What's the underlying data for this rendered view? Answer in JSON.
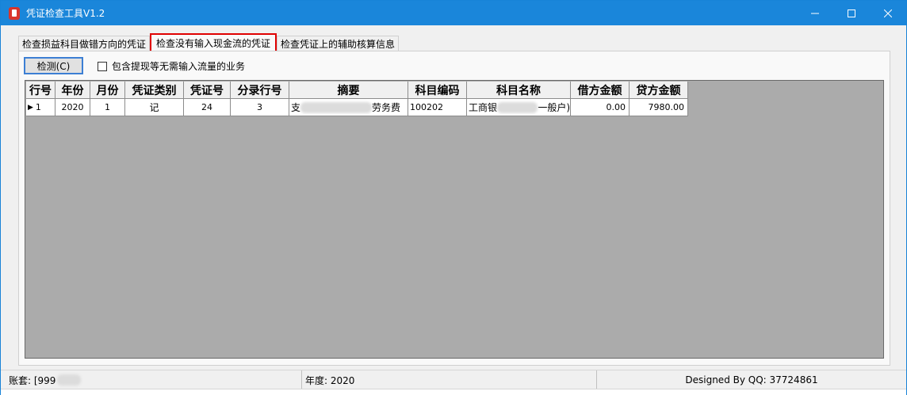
{
  "window": {
    "title": "凭证检查工具V1.2",
    "controls": {
      "minimize": "—",
      "maximize": "☐",
      "close": "✕"
    }
  },
  "tabs": [
    {
      "label": "检查损益科目做错方向的凭证",
      "active": false
    },
    {
      "label": "检查没有输入现金流的凭证",
      "active": true
    },
    {
      "label": "检查凭证上的辅助核算信息",
      "active": false
    }
  ],
  "toolbar": {
    "detect_label": "检测(C)",
    "checkbox_label": "包含提现等无需输入流量的业务",
    "checkbox_checked": false
  },
  "grid": {
    "columns": [
      "行号",
      "年份",
      "月份",
      "凭证类别",
      "凭证号",
      "分录行号",
      "摘要",
      "科目编码",
      "科目名称",
      "借方金额",
      "贷方金额"
    ],
    "rows": [
      {
        "row_no": "1",
        "year": "2020",
        "month": "1",
        "voucher_type": "记",
        "voucher_no": "24",
        "entry_no": "3",
        "summary_start": "支",
        "summary_end": "劳务费",
        "account_code": "100202",
        "account_name_start": "工商银",
        "account_name_end": "一般户)",
        "debit": "0.00",
        "credit": "7980.00"
      }
    ]
  },
  "status": {
    "account_set": "账套: [999",
    "year": "年度: 2020",
    "designer": "Designed By QQ: 37724861"
  },
  "colors": {
    "titlebar": "#1a86da",
    "active_tab_border": "#e00000",
    "grid_background": "#ababab"
  }
}
